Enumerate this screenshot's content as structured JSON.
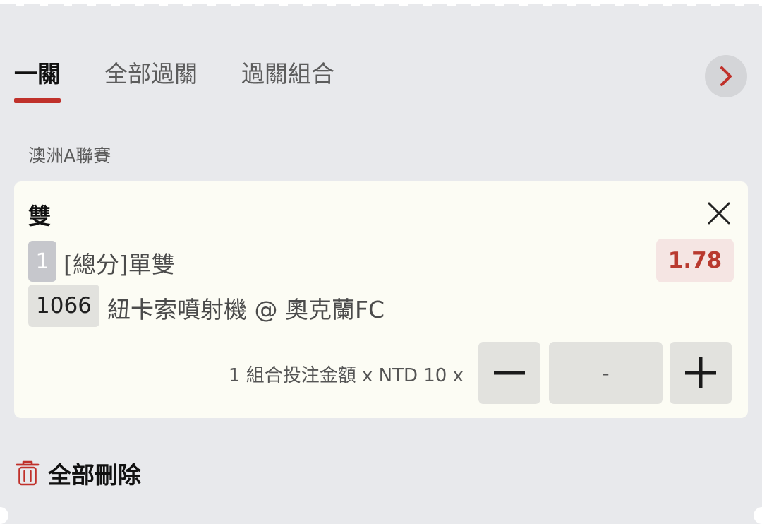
{
  "tabs": [
    {
      "label": "一關",
      "active": true
    },
    {
      "label": "全部過關",
      "active": false
    },
    {
      "label": "過關組合",
      "active": false
    }
  ],
  "next_icon": "chevron-right-icon",
  "league": "澳洲A聯賽",
  "bet": {
    "selection": "雙",
    "leg_number": "1",
    "market": "[總分]單雙",
    "odds": "1.78",
    "match_code": "1066",
    "match_name": "紐卡索噴射機 @ 奧克蘭FC",
    "stake_label": "1 組合投注金額 x NTD 10 x",
    "amount": "-"
  },
  "delete_all_label": "全部刪除",
  "colors": {
    "accent": "#c0312b",
    "odds_text": "#b93a2f",
    "odds_bg": "#f5e5e3",
    "card_bg": "#fcfcf4",
    "page_bg": "#e8e9ec"
  }
}
